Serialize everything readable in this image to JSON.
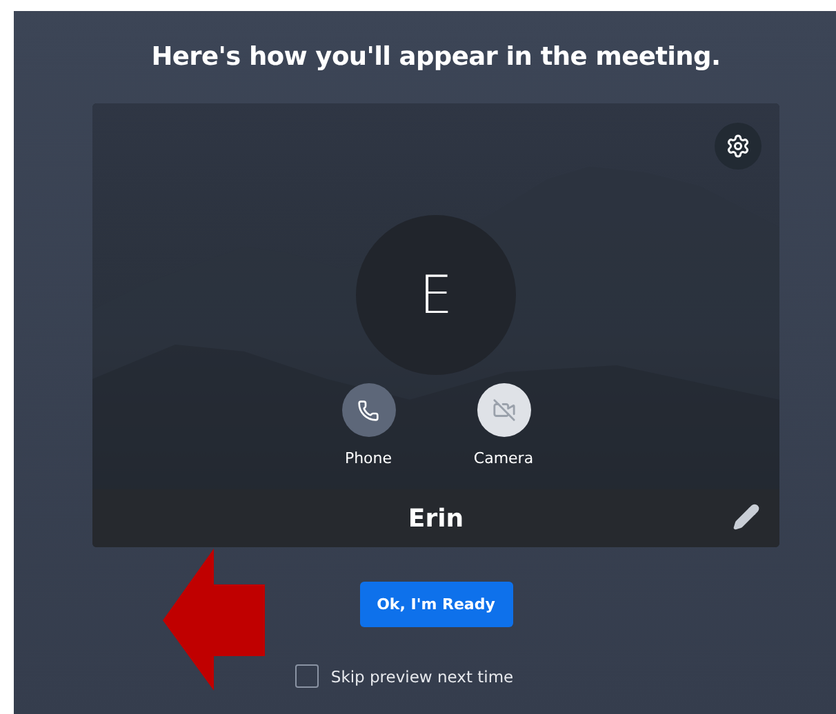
{
  "heading": "Here's how you'll appear in the meeting.",
  "preview": {
    "avatar_initial": "E",
    "controls": [
      {
        "kind": "phone",
        "label": "Phone",
        "on": true
      },
      {
        "kind": "camera",
        "label": "Camera",
        "on": false
      }
    ],
    "name": "Erin"
  },
  "primary_button": "Ok, I'm Ready",
  "skip_preview": {
    "label": "Skip preview next time",
    "checked": false
  },
  "annotation": {
    "kind": "arrow"
  }
}
